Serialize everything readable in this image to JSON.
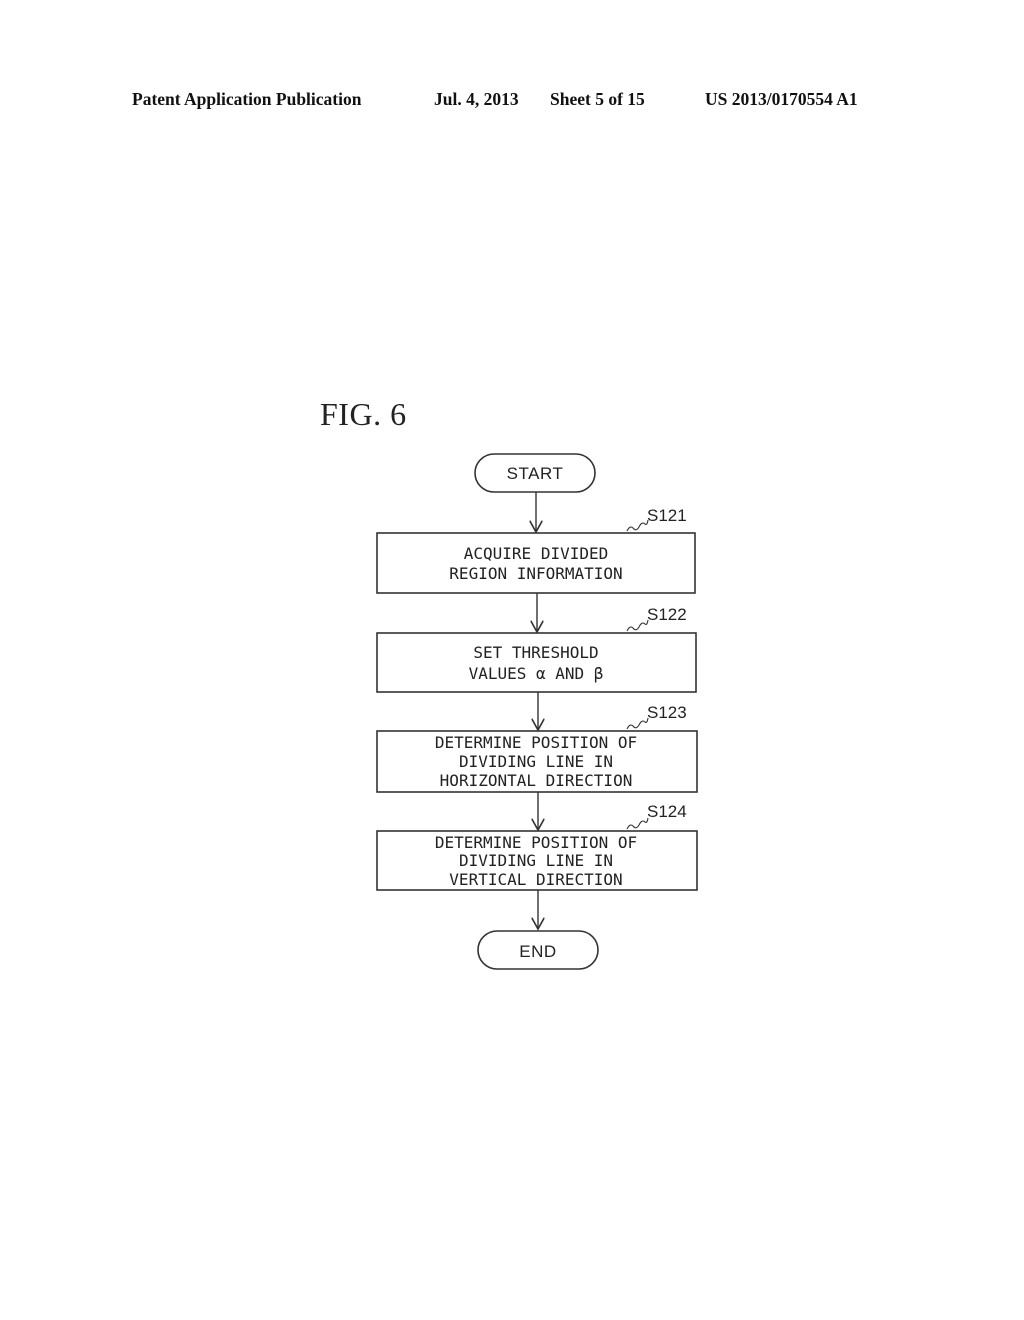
{
  "header": {
    "publication_type": "Patent Application Publication",
    "date": "Jul. 4, 2013",
    "sheet": "Sheet 5 of 15",
    "publication_number": "US 2013/0170554 A1"
  },
  "figure": {
    "label": "FIG. 6"
  },
  "flowchart": {
    "start": "START",
    "end": "END",
    "steps": [
      {
        "id": "S121",
        "lines": [
          "ACQUIRE DIVIDED",
          "REGION INFORMATION"
        ]
      },
      {
        "id": "S122",
        "lines": [
          "SET THRESHOLD",
          "VALUES α AND β"
        ]
      },
      {
        "id": "S123",
        "lines": [
          "DETERMINE POSITION OF",
          "DIVIDING LINE IN",
          "HORIZONTAL DIRECTION"
        ]
      },
      {
        "id": "S124",
        "lines": [
          "DETERMINE POSITION OF",
          "DIVIDING LINE IN",
          "VERTICAL DIRECTION"
        ]
      }
    ]
  }
}
